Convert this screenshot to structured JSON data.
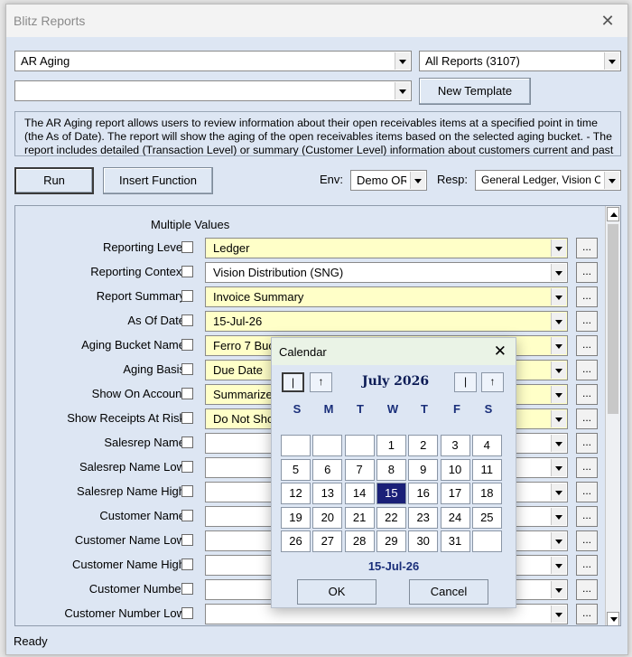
{
  "window": {
    "title": "Blitz Reports",
    "close_glyph": "✕"
  },
  "report_combo": {
    "value": "AR Aging"
  },
  "category_combo": {
    "value": "All Reports (3107)"
  },
  "template_combo": {
    "value": ""
  },
  "buttons": {
    "new_template": "New Template",
    "run": "Run",
    "insert_function": "Insert Function"
  },
  "description": "The AR Aging report allows users to review information about their open receivables items at a specified point in time (the As of Date). The report will show the aging of the open receivables items based on the selected aging bucket. - The report includes detailed (Transaction Level) or summary (Customer Level) information about customers current and past due",
  "env": {
    "label": "Env:",
    "value": "Demo OR"
  },
  "resp": {
    "label": "Resp:",
    "value": "General Ledger, Vision Op"
  },
  "params": {
    "multiple_values_label": "Multiple Values",
    "rows": [
      {
        "label": "Reporting Level",
        "value": "Ledger",
        "required": true
      },
      {
        "label": "Reporting Context",
        "value": "Vision Distribution (SNG)",
        "required": false
      },
      {
        "label": "Report Summary",
        "value": "Invoice Summary",
        "required": true
      },
      {
        "label": "As Of Date",
        "value": "15-Jul-26",
        "required": true
      },
      {
        "label": "Aging Bucket Name",
        "value": "Ferro 7 Buc",
        "required": true
      },
      {
        "label": "Aging Basis",
        "value": "Due Date",
        "required": true
      },
      {
        "label": "Show On Account",
        "value": "Summarize",
        "required": true
      },
      {
        "label": "Show Receipts At Risk",
        "value": "Do Not Sho",
        "required": true
      },
      {
        "label": "Salesrep Name",
        "value": "",
        "required": false
      },
      {
        "label": "Salesrep Name Low",
        "value": "",
        "required": false
      },
      {
        "label": "Salesrep Name High",
        "value": "",
        "required": false
      },
      {
        "label": "Customer Name",
        "value": "",
        "required": false
      },
      {
        "label": "Customer Name Low",
        "value": "",
        "required": false
      },
      {
        "label": "Customer Name High",
        "value": "",
        "required": false
      },
      {
        "label": "Customer Number",
        "value": "",
        "required": false
      },
      {
        "label": "Customer Number Low",
        "value": "",
        "required": false
      }
    ],
    "dots_label": "..."
  },
  "status": "Ready",
  "calendar": {
    "title": "Calendar",
    "close_glyph": "✕",
    "month": "July 2026",
    "nav_prev_year": "|",
    "nav_prev_month": "↑",
    "nav_next_month": "|",
    "nav_next_year": "↑",
    "weekdays": [
      "S",
      "M",
      "T",
      "W",
      "T",
      "F",
      "S"
    ],
    "days": [
      "",
      "",
      "",
      "1",
      "2",
      "3",
      "4",
      "5",
      "6",
      "7",
      "8",
      "9",
      "10",
      "11",
      "12",
      "13",
      "14",
      "15",
      "16",
      "17",
      "18",
      "19",
      "20",
      "21",
      "22",
      "23",
      "24",
      "25",
      "26",
      "27",
      "28",
      "29",
      "30",
      "31",
      ""
    ],
    "selected_day": "15",
    "selected_date": "15-Jul-26",
    "ok": "OK",
    "cancel": "Cancel"
  },
  "colors": {
    "required_field": "#ffffc8",
    "selected_day": "#1a2078",
    "panel": "#dde6f3"
  }
}
